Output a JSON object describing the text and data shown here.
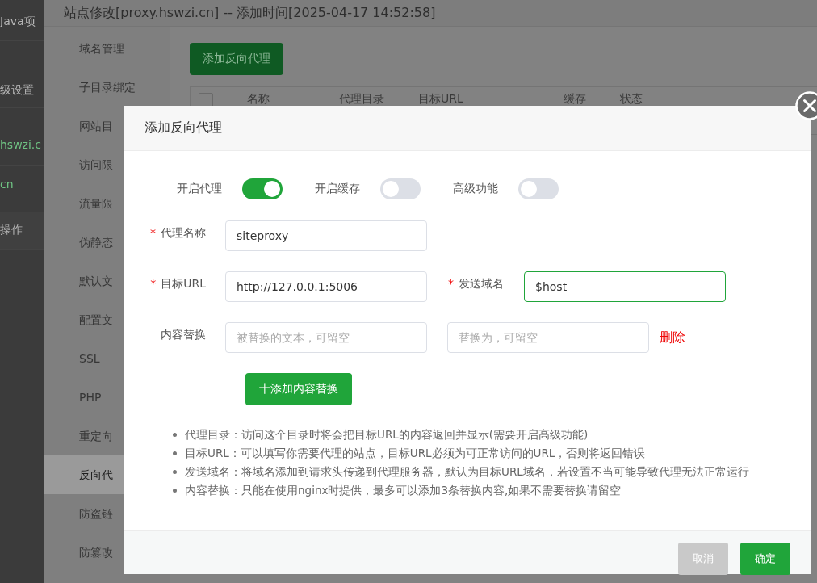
{
  "outer_app": {
    "items": [
      {
        "text": "Java项",
        "kind": "text"
      },
      {
        "text": "级设置",
        "kind": "text"
      },
      {
        "text": "hswzi.c",
        "kind": "link"
      },
      {
        "text": "cn",
        "kind": "link"
      },
      {
        "text": "操作",
        "kind": "text"
      }
    ]
  },
  "site_panel": {
    "title": "站点修改[proxy.hswzi.cn] -- 添加时间[2025-04-17 14:52:58]",
    "menu": [
      {
        "label": "域名管理",
        "selected": false
      },
      {
        "label": "子目录绑定",
        "selected": false
      },
      {
        "label": "网站目",
        "selected": false
      },
      {
        "label": "访问限",
        "selected": false
      },
      {
        "label": "流量限",
        "selected": false
      },
      {
        "label": "伪静态",
        "selected": false
      },
      {
        "label": "默认文",
        "selected": false
      },
      {
        "label": "配置文",
        "selected": false
      },
      {
        "label": "SSL",
        "selected": false
      },
      {
        "label": "PHP",
        "selected": false
      },
      {
        "label": "重定向",
        "selected": false
      },
      {
        "label": "反向代",
        "selected": true
      },
      {
        "label": "防盗链",
        "selected": false
      },
      {
        "label": "防篡改",
        "selected": false
      }
    ],
    "add_button": "添加反向代理",
    "select_all_checked": false,
    "table_columns": [
      "名称",
      "代理目录",
      "目标URL",
      "缓存",
      "状态"
    ]
  },
  "dialog": {
    "title": "添加反向代理",
    "switches": [
      {
        "label": "开启代理",
        "on": true
      },
      {
        "label": "开启缓存",
        "on": false
      },
      {
        "label": "高级功能",
        "on": false
      }
    ],
    "form_rows": [
      {
        "fields": [
          {
            "label": "代理名称",
            "required_mark": "*",
            "value": "siteproxy",
            "focused": false
          }
        ]
      },
      {
        "fields": [
          {
            "label": "目标URL",
            "required_mark": "*",
            "value": "http://127.0.0.1:5006",
            "focused": false
          },
          {
            "label": "发送域名",
            "required_mark": "*",
            "value": "$host",
            "focused": true
          }
        ]
      },
      {
        "fields": [
          {
            "label": "内容替换",
            "placeholder": "被替换的文本，可留空",
            "focused": false
          },
          {
            "placeholder": "替换为，可留空",
            "focused": false
          }
        ],
        "delete_link": "删除"
      }
    ],
    "add_replace_button": "十添加内容替换",
    "notes": [
      "代理目录：访问这个目录时将会把目标URL的内容返回并显示(需要开启高级功能)",
      "目标URL：可以填写你需要代理的站点，目标URL必须为可正常访问的URL，否则将返回错误",
      "发送域名：将域名添加到请求头传递到代理服务器，默认为目标URL域名，若设置不当可能导致代理无法正常运行",
      "内容替换：只能在使用nginx时提供，最多可以添加3条替换内容,如果不需要替换请留空"
    ],
    "buttons": [
      {
        "label": "取消",
        "kind": "secondary"
      },
      {
        "label": "确定",
        "kind": "primary"
      }
    ]
  }
}
